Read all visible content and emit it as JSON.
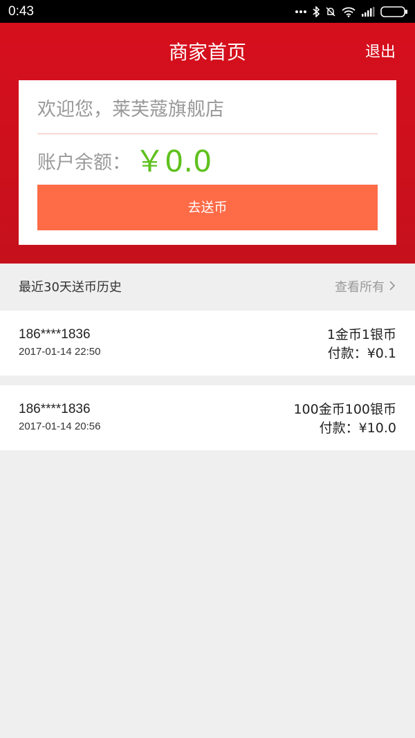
{
  "status_bar": {
    "time": "0:43",
    "icons": [
      "dots-icon",
      "bluetooth-icon",
      "alarm-off-icon",
      "wifi-icon",
      "signal-icon",
      "battery-icon"
    ]
  },
  "header": {
    "title": "商家首页",
    "logout_label": "退出",
    "background_color": "#d70f1d"
  },
  "account_card": {
    "welcome_text": "欢迎您，莱芙蔻旗舰店",
    "balance_label": "账户余额：",
    "balance_value": "￥0.0",
    "balance_color": "#5fc11e",
    "send_button_label": "去送币",
    "send_button_color": "#fd6b47"
  },
  "history": {
    "title": "最近30天送币历史",
    "view_all_label": "查看所有",
    "records": [
      {
        "phone": "186****1836",
        "time": "2017-01-14 22:50",
        "coins": "1金币1银币",
        "payment": "付款：¥0.1"
      },
      {
        "phone": "186****1836",
        "time": "2017-01-14 20:56",
        "coins": "100金币100银币",
        "payment": "付款：¥10.0"
      }
    ]
  }
}
